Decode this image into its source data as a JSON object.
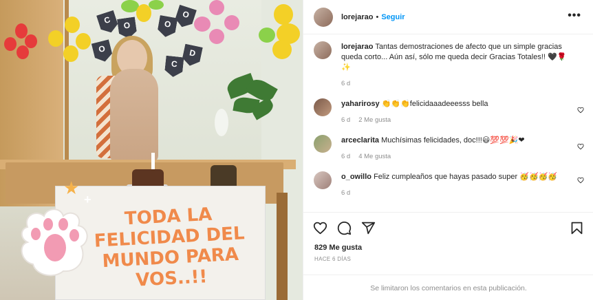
{
  "post": {
    "author": {
      "username": "lorejarao",
      "follow_label": "Seguir",
      "separator": "•"
    },
    "more_icon": "more-horizontal-icon",
    "photo": {
      "banner_text": "TODA LA FELICIDAD DEL MUNDO PARA VOS..!!",
      "bunting_letters": [
        "C",
        "O",
        "O",
        "C",
        "O",
        "O",
        "D"
      ],
      "colors": {
        "banner_text": "#f08a4b"
      }
    },
    "caption": {
      "username": "lorejarao",
      "text": "Tantas demostraciones de afecto que un simple gracias queda corto... Aún así, sólo me queda decir Gracias Totales!! 🖤🌹✨",
      "time": "6 d"
    },
    "comments": [
      {
        "username": "yaharirosy",
        "text": "👏👏👏felicidaaadeeesss bella",
        "time": "6 d",
        "likes": "2 Me gusta"
      },
      {
        "username": "arceclarita",
        "text": "Muchísimas felicidades, doc!!!😃💯💯🎉❤",
        "time": "6 d",
        "likes": "4 Me gusta"
      },
      {
        "username": "o_owillo",
        "text": "Feliz cumpleaños que hayas pasado super 🥳🥳🥳🥳",
        "time": "6 d",
        "likes": ""
      }
    ],
    "actions": {
      "like_icon": "heart-icon",
      "comment_icon": "comment-icon",
      "share_icon": "send-icon",
      "save_icon": "bookmark-icon"
    },
    "likes_count": "829 Me gusta",
    "posted_ago": "HACE 6 DÍAS",
    "comments_limited": "Se limitaron los comentarios en esta publicación.",
    "colors": {
      "link": "#0095f6",
      "muted": "#8e8e8e",
      "text": "#262626",
      "border": "#efefef"
    }
  }
}
